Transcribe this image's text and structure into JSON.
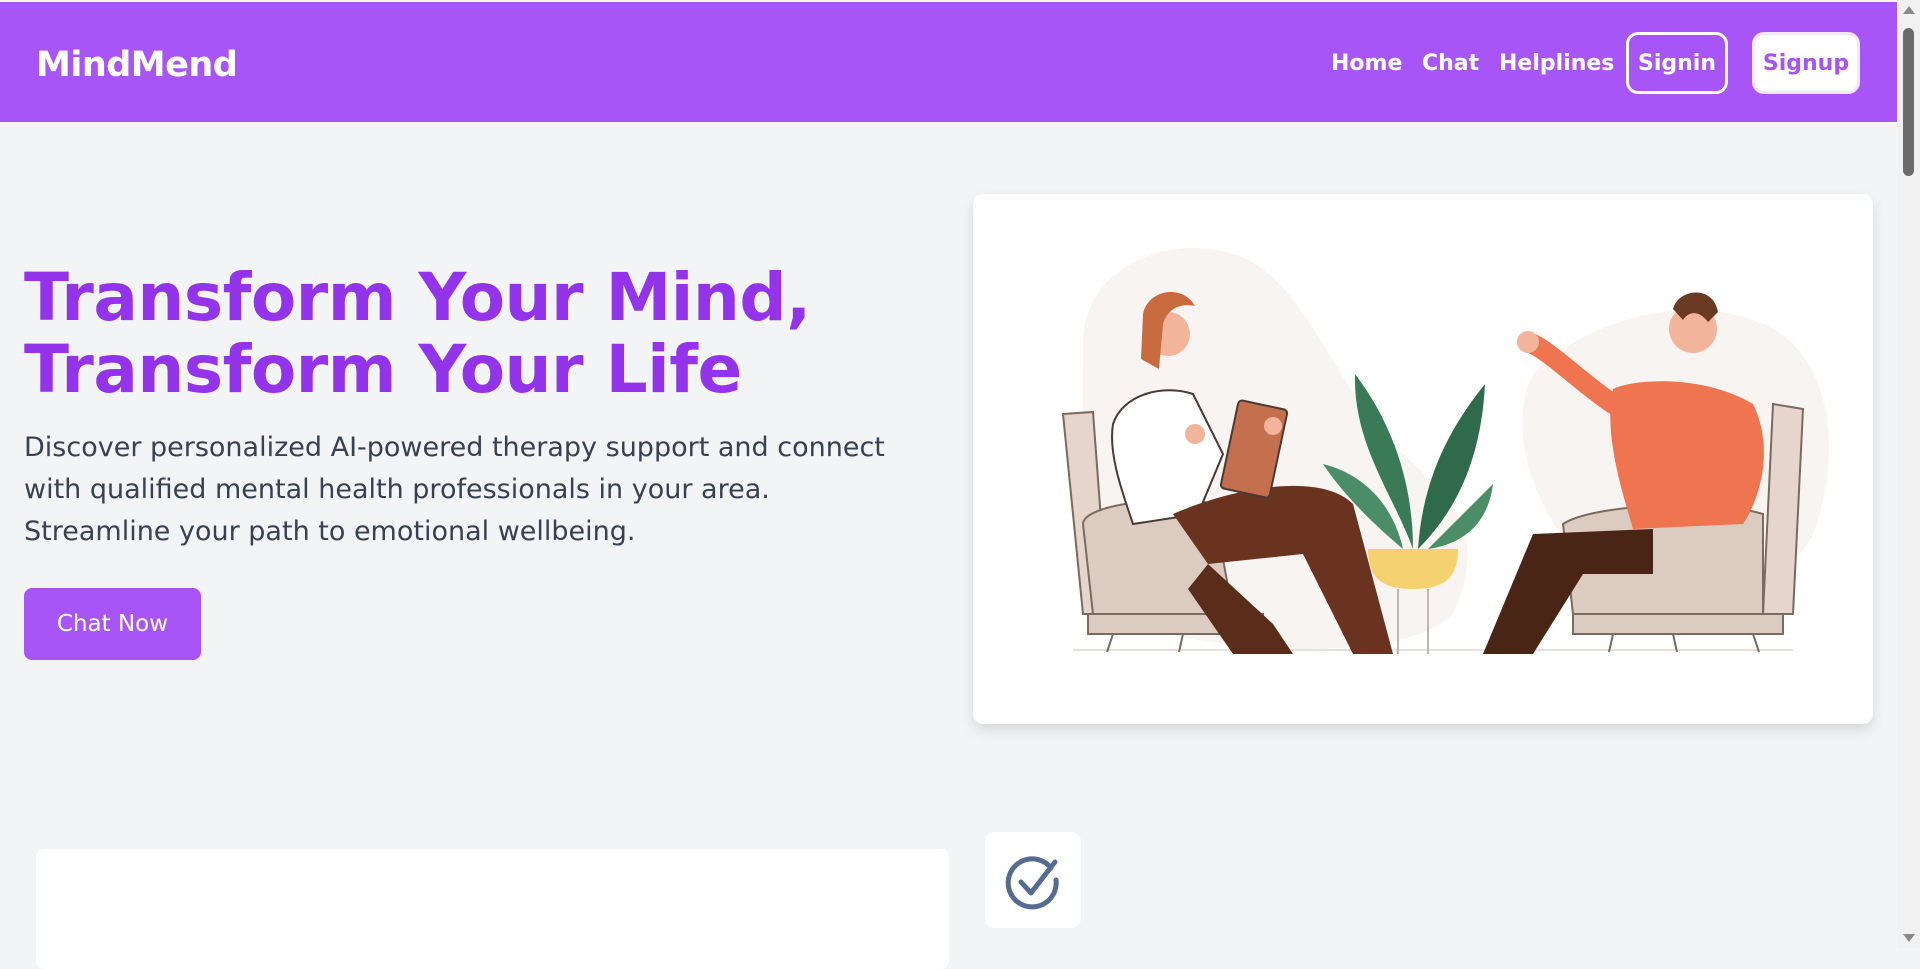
{
  "navbar": {
    "brand": "MindMend",
    "links": [
      "Home",
      "Chat",
      "Helplines"
    ],
    "signin_label": "Signin",
    "signup_label": "Signup"
  },
  "hero": {
    "title_line1": "Transform Your Mind,",
    "title_line2": "Transform Your Life",
    "description": "Discover personalized AI-powered therapy support and connect with qualified mental health professionals in your area. Streamline your path to emotional wellbeing.",
    "cta_label": "Chat Now"
  },
  "illustration": {
    "subject": "therapy-session-illustration"
  },
  "icons": {
    "feature": "check-circle-icon"
  },
  "colors": {
    "accent": "#a855f7",
    "title": "#9333ea",
    "background": "#f3f4f6"
  }
}
